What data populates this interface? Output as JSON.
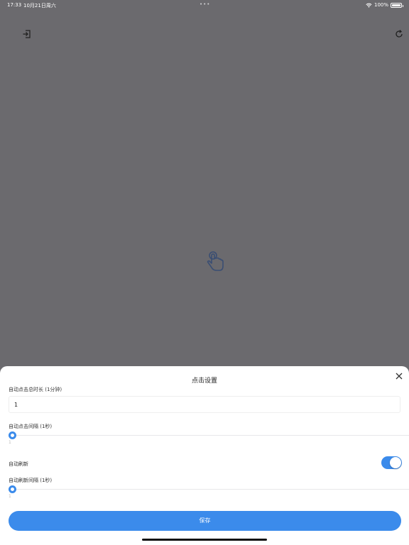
{
  "status_bar": {
    "time": "17:33",
    "date": "10月21日周六",
    "dots": "•••",
    "battery": "100%"
  },
  "icons": {
    "exit": "exit-icon",
    "refresh": "refresh-icon",
    "hand": "tap-hand-icon",
    "close": "close-icon"
  },
  "sheet": {
    "title": "点击设置",
    "total_duration_label": "自动点击总时长 (1分钟)",
    "total_duration_value": "1",
    "click_interval_label": "自动点击间隔 (1秒)",
    "click_interval_value": "1",
    "auto_refresh_label": "自动刷新",
    "auto_refresh_enabled": true,
    "refresh_interval_label": "自动刷新间隔 (1秒)",
    "refresh_interval_value": "1",
    "save_label": "保存"
  },
  "colors": {
    "accent": "#3b8beb",
    "overlay": "#6b6a6e"
  }
}
